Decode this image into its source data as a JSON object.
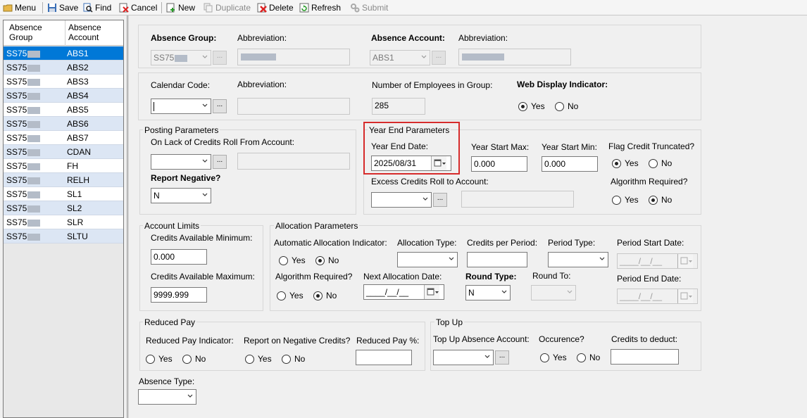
{
  "toolbar": {
    "menu": "Menu",
    "save": "Save",
    "find": "Find",
    "cancel": "Cancel",
    "new": "New",
    "duplicate": "Duplicate",
    "delete": "Delete",
    "refresh": "Refresh",
    "submit": "Submit"
  },
  "list": {
    "col1": "Absence Group",
    "col2": "Absence Account",
    "rows": [
      {
        "group": "SS75",
        "account": "ABS1"
      },
      {
        "group": "SS75",
        "account": "ABS2"
      },
      {
        "group": "SS75",
        "account": "ABS3"
      },
      {
        "group": "SS75",
        "account": "ABS4"
      },
      {
        "group": "SS75",
        "account": "ABS5"
      },
      {
        "group": "SS75",
        "account": "ABS6"
      },
      {
        "group": "SS75",
        "account": "ABS7"
      },
      {
        "group": "SS75",
        "account": "CDAN"
      },
      {
        "group": "SS75",
        "account": "FH"
      },
      {
        "group": "SS75",
        "account": "RELH"
      },
      {
        "group": "SS75",
        "account": "SL1"
      },
      {
        "group": "SS75",
        "account": "SL2"
      },
      {
        "group": "SS75",
        "account": "SLR"
      },
      {
        "group": "SS75",
        "account": "SLTU"
      }
    ]
  },
  "header": {
    "absence_group_label": "Absence Group:",
    "abbreviation_label": "Abbreviation:",
    "absence_group_value": "SS75",
    "absence_account_label": "Absence Account:",
    "absence_account_value": "ABS1"
  },
  "calendar": {
    "calendar_code_label": "Calendar Code:",
    "abbreviation_label": "Abbreviation:",
    "num_employees_label": "Number of Employees in Group:",
    "num_employees_value": "285",
    "web_display_label": "Web Display Indicator:",
    "yes": "Yes",
    "no": "No"
  },
  "posting": {
    "title": "Posting Parameters",
    "on_lack_label": "On Lack of Credits Roll From Account:",
    "report_negative_label": "Report Negative?",
    "report_negative_value": "N"
  },
  "year_end": {
    "title": "Year End Parameters",
    "date_label": "Year End Date:",
    "date_value": "2025/08/31",
    "start_max_label": "Year Start Max:",
    "start_max_value": "0.000",
    "start_min_label": "Year Start Min:",
    "start_min_value": "0.000",
    "flag_credit_label": "Flag Credit Truncated?",
    "excess_label": "Excess Credits Roll to Account:",
    "algorithm_label": "Algorithm Required?",
    "yes": "Yes",
    "no": "No"
  },
  "limits": {
    "title": "Account Limits",
    "min_label": "Credits Available Minimum:",
    "min_value": "0.000",
    "max_label": "Credits Available Maximum:",
    "max_value": "9999.999"
  },
  "allocation": {
    "title": "Allocation Parameters",
    "auto_label": "Automatic Allocation Indicator:",
    "type_label": "Allocation Type:",
    "credits_label": "Credits per Period:",
    "period_type_label": "Period Type:",
    "period_start_label": "Period Start Date:",
    "algorithm_label": "Algorithm Required?",
    "next_date_label": "Next Allocation Date:",
    "round_type_label": "Round Type:",
    "round_type_value": "N",
    "round_to_label": "Round To:",
    "period_end_label": "Period End Date:",
    "empty_date": "____/__/__",
    "yes": "Yes",
    "no": "No"
  },
  "reduced": {
    "title": "Reduced Pay",
    "indicator_label": "Reduced Pay Indicator:",
    "report_label": "Report on Negative Credits?",
    "pct_label": "Reduced Pay %:",
    "yes": "Yes",
    "no": "No"
  },
  "topup": {
    "title": "Top Up",
    "account_label": "Top Up Absence Account:",
    "occurence_label": "Occurence?",
    "deduct_label": "Credits to deduct:",
    "yes": "Yes",
    "no": "No"
  },
  "absence_type_label": "Absence Type:",
  "colors": {
    "selected_row": "#0078d7",
    "alt_row": "#dce6f4",
    "highlight": "#d62b2b"
  }
}
